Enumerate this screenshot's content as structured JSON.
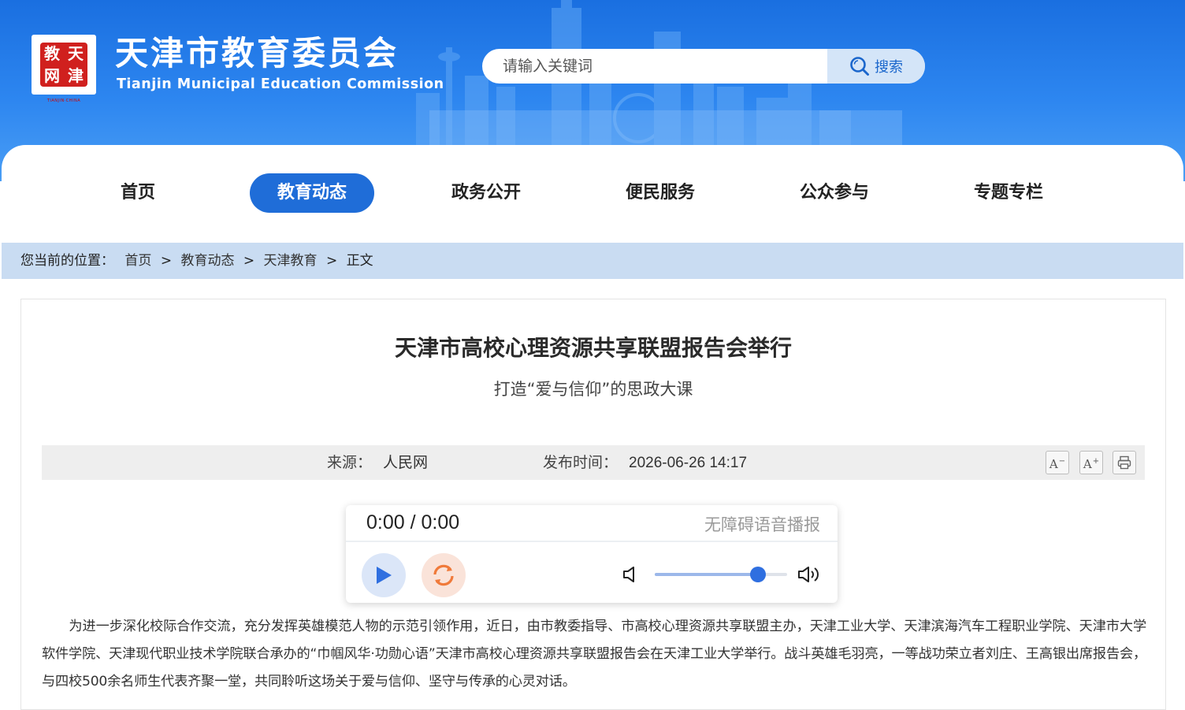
{
  "header": {
    "seal_chars": [
      "天",
      "津",
      "教",
      "网"
    ],
    "seal_caption": "TIANJIN·CHINA",
    "site_name": "天津市教育委员会",
    "site_name_en": "Tianjin Municipal Education Commission",
    "search": {
      "placeholder": "请输入关键词",
      "value": "",
      "button_label": "搜索",
      "button_icon": "search-icon"
    }
  },
  "nav": {
    "items": [
      {
        "label": "首页",
        "active": false
      },
      {
        "label": "教育动态",
        "active": true
      },
      {
        "label": "政务公开",
        "active": false
      },
      {
        "label": "便民服务",
        "active": false
      },
      {
        "label": "公众参与",
        "active": false
      },
      {
        "label": "专题专栏",
        "active": false
      }
    ],
    "active_color": "#1f6dd8"
  },
  "breadcrumb": {
    "prefix": "您当前的位置：",
    "items": [
      "首页",
      "教育动态",
      "天津教育",
      "正文"
    ],
    "separator": ">"
  },
  "article": {
    "title": "天津市高校心理资源共享联盟报告会举行",
    "subtitle": "打造“爱与信仰”的思政大课",
    "source_label": "来源：",
    "source": "人民网",
    "date_label": "发布时间：",
    "date": "2026-06-26 14:17",
    "tools": {
      "font_smaller_icon": "font-decrease-icon",
      "font_larger_icon": "font-increase-icon",
      "print_icon": "print-icon"
    },
    "player": {
      "time": "0:00 / 0:00",
      "label": "无障碍语音播报",
      "volume": 0.78,
      "play_icon": "play-icon",
      "loop_icon": "loop-icon",
      "mute_icon": "speaker-mute-icon",
      "loud_icon": "speaker-loud-icon"
    },
    "body": "为进一步深化校际合作交流，充分发挥英雄模范人物的示范引领作用，近日，由市教委指导、市高校心理资源共享联盟主办，天津工业大学、天津滨海汽车工程职业学院、天津市大学软件学院、天津现代职业技术学院联合承办的“巾帼风华·功勋心语”天津市高校心理资源共享联盟报告会在天津工业大学举行。战斗英雄毛羽亮，一等战功荣立者刘庄、王高银出席报告会，与四校500余名师生代表齐聚一堂，共同聆听这场关于爱与信仰、坚守与传承的心灵对话。"
  },
  "colors": {
    "header_blue": "#2d86f0",
    "breadcrumb_bg": "#c9dcf2",
    "accent": "#2f6fe0"
  }
}
